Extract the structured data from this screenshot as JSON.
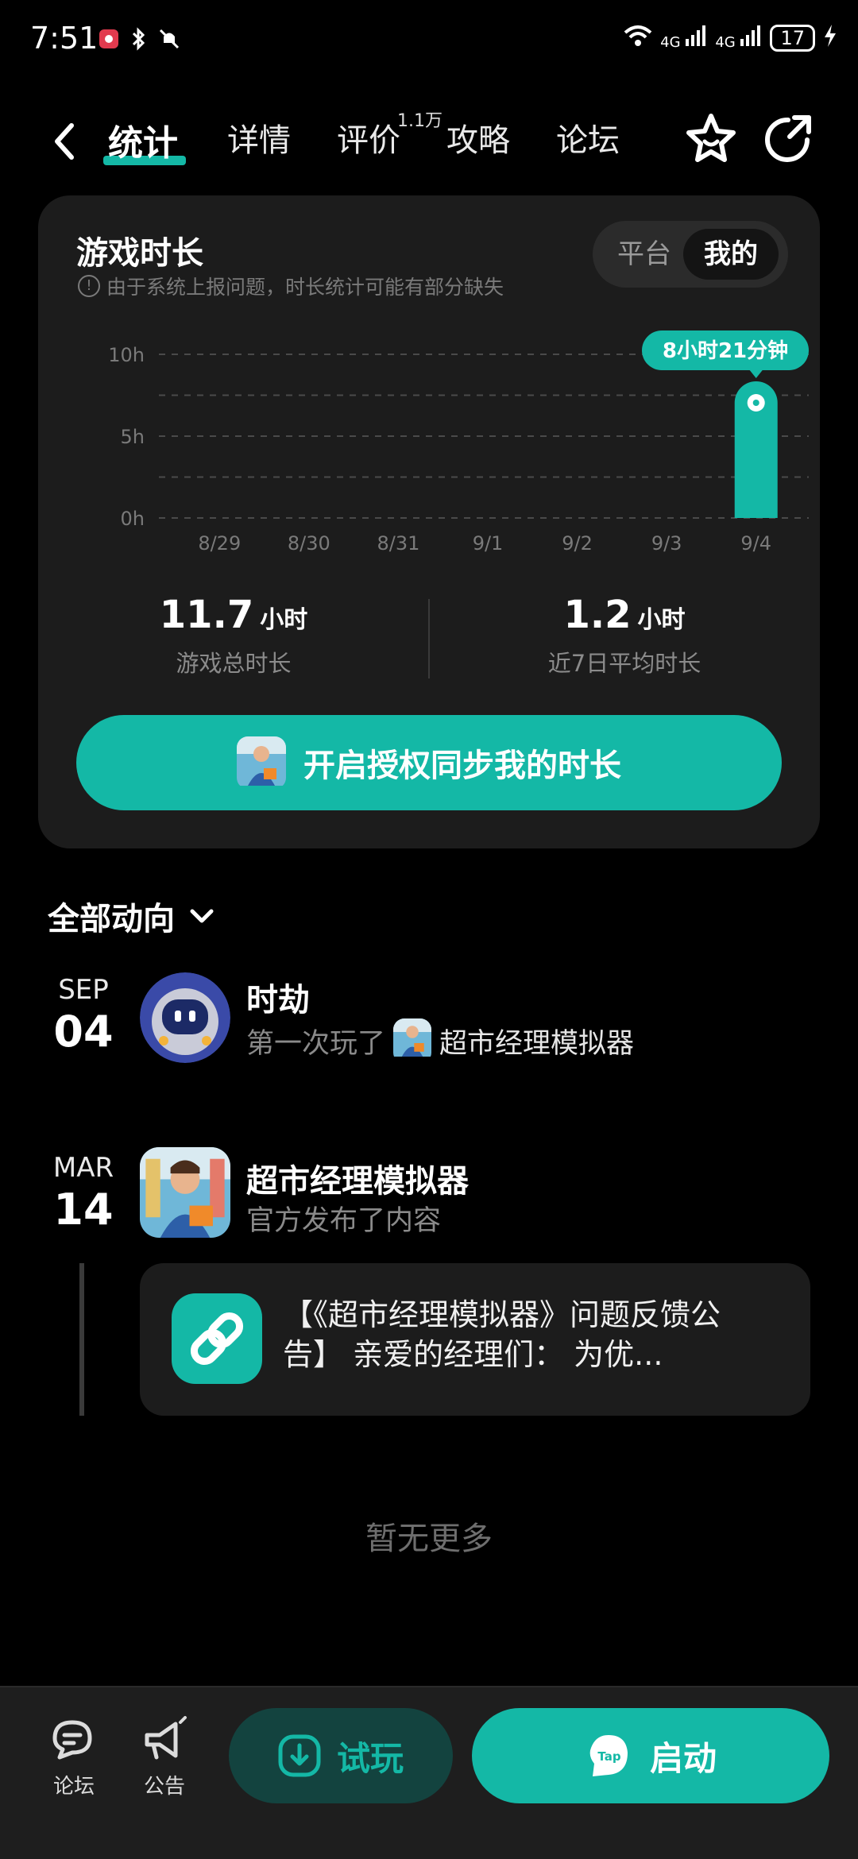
{
  "status_bar": {
    "time": "7:51",
    "battery": "17",
    "signal1": "4G",
    "signal2": "4G"
  },
  "nav": {
    "tabs": [
      {
        "label": "统计"
      },
      {
        "label": "详情"
      },
      {
        "label": "评价"
      },
      {
        "label": "攻略"
      },
      {
        "label": "论坛"
      }
    ],
    "review_count": "1.1万"
  },
  "playtime_card": {
    "title": "游戏时长",
    "notice": "由于系统上报问题，时长统计可能有部分缺失",
    "toggle": [
      "平台",
      "我的"
    ],
    "selected_toggle": "我的",
    "tooltip": "8小时21分钟",
    "total": {
      "value": "11.7",
      "unit": "小时",
      "label": "游戏总时长"
    },
    "avg": {
      "value": "1.2",
      "unit": "小时",
      "label": "近7日平均时长"
    },
    "sync_button": "开启授权同步我的时长"
  },
  "chart_data": {
    "type": "bar",
    "categories": [
      "8/29",
      "8/30",
      "8/31",
      "9/1",
      "9/2",
      "9/3",
      "9/4"
    ],
    "values": [
      0,
      0,
      0,
      0,
      0,
      0,
      8.35
    ],
    "y_ticks": [
      "0h",
      "5h",
      "10h"
    ],
    "ylim": [
      0,
      10
    ],
    "grid": true,
    "bar_color": "#14b8a6"
  },
  "activity": {
    "header": "全部动向",
    "items": [
      {
        "month": "SEP",
        "day": "04",
        "name": "时劫",
        "action": "第一次玩了",
        "game": "超市经理模拟器"
      },
      {
        "month": "MAR",
        "day": "14",
        "name": "超市经理模拟器",
        "action": "官方发布了内容",
        "post": "【《超市经理模拟器》问题反馈公告】 亲爱的经理们： 为优..."
      }
    ],
    "no_more": "暂无更多"
  },
  "bottom": {
    "forum": "论坛",
    "notice": "公告",
    "try": "试玩",
    "launch": "启动",
    "tap_logo": "Tap"
  },
  "colors": {
    "accent": "#14b8a6",
    "card": "#1c1c1c",
    "background": "#000000"
  }
}
